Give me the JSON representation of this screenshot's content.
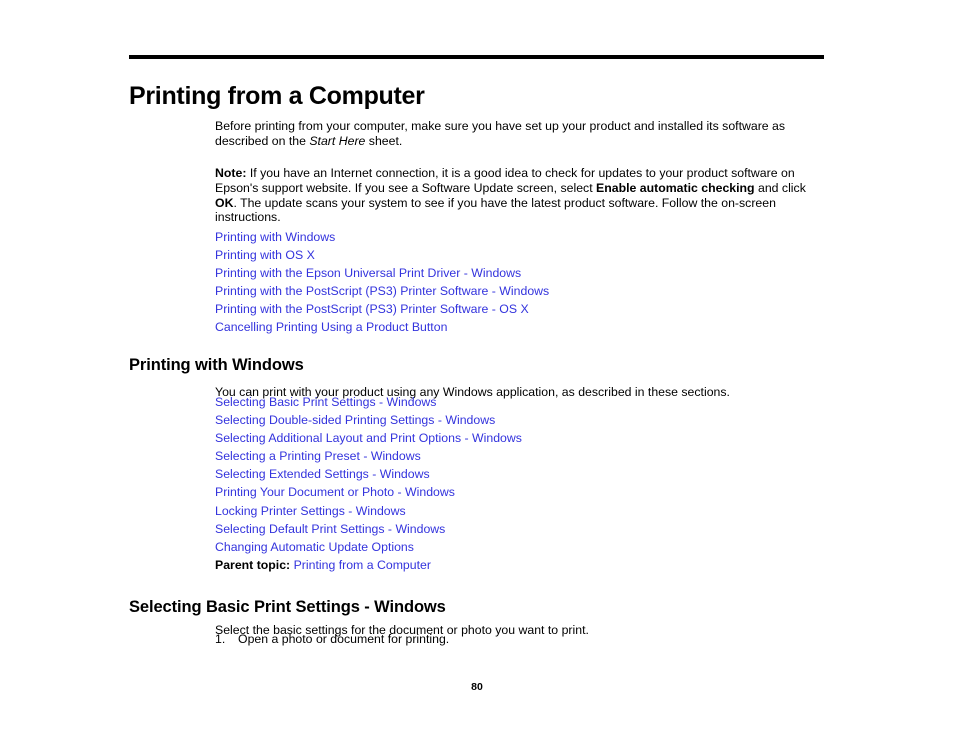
{
  "document": {
    "title": "Printing from a Computer",
    "page_number": "80"
  },
  "intro": {
    "text_part1": "Before printing from your computer, make sure you have set up your product and installed its software as described on the ",
    "italic_run": "Start Here",
    "text_part2": " sheet."
  },
  "note": {
    "label": "Note:",
    "text_part1": " If you have an Internet connection, it is a good idea to check for updates to your product software on Epson's support website. If you see a Software Update screen, select ",
    "bold_run1": "Enable automatic checking",
    "text_part2": " and click ",
    "bold_run2": "OK",
    "text_part3": ". The update scans your system to see if you have the latest product software. Follow the on-screen instructions."
  },
  "toc_main": {
    "links": [
      "Printing with Windows",
      "Printing with OS X",
      "Printing with the Epson Universal Print Driver - Windows",
      "Printing with the PostScript (PS3) Printer Software - Windows",
      "Printing with the PostScript (PS3) Printer Software - OS X",
      "Cancelling Printing Using a Product Button"
    ]
  },
  "section_windows": {
    "heading": "Printing with Windows",
    "intro": "You can print with your product using any Windows application, as described in these sections.",
    "links": [
      "Selecting Basic Print Settings - Windows",
      "Selecting Double-sided Printing Settings - Windows",
      "Selecting Additional Layout and Print Options - Windows",
      "Selecting a Printing Preset - Windows",
      "Selecting Extended Settings - Windows",
      "Printing Your Document or Photo - Windows",
      "Locking Printer Settings - Windows",
      "Selecting Default Print Settings - Windows",
      "Changing Automatic Update Options"
    ],
    "parent_topic_label": "Parent topic:",
    "parent_topic_link": "Printing from a Computer"
  },
  "section_basic": {
    "heading": "Selecting Basic Print Settings - Windows",
    "intro": "Select the basic settings for the document or photo you want to print.",
    "steps": [
      {
        "number": "1.",
        "text": "Open a photo or document for printing."
      }
    ]
  },
  "colors": {
    "link": "#3333DD",
    "text": "#000000",
    "rule": "#000000"
  }
}
